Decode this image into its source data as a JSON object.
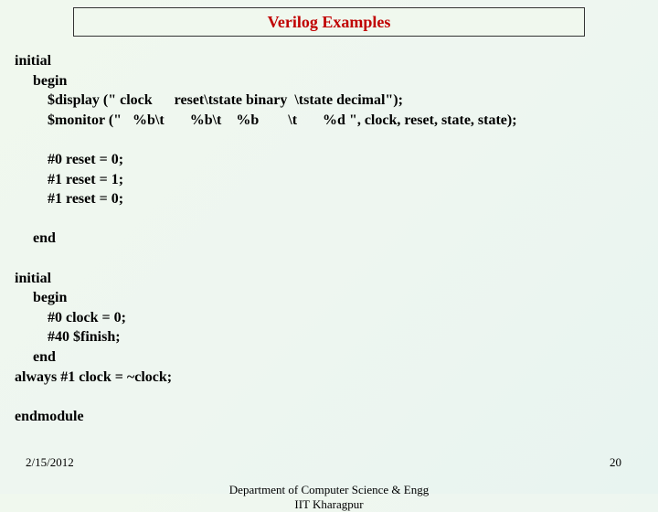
{
  "title": "Verilog Examples",
  "code": "initial\n     begin\n         $display (\" clock      reset\\tstate binary  \\tstate decimal\");\n         $monitor (\"   %b\\t       %b\\t    %b        \\t       %d \", clock, reset, state, state);\n\n         #0 reset = 0;\n         #1 reset = 1;\n         #1 reset = 0;\n\n     end\n\ninitial\n     begin\n         #0 clock = 0;\n         #40 $finish;\n     end\nalways #1 clock = ~clock;\n\nendmodule",
  "footer": {
    "date": "2/15/2012",
    "dept_line1": "Department of Computer Science & Engg",
    "dept_line2": "IIT Kharagpur",
    "page": "20"
  }
}
